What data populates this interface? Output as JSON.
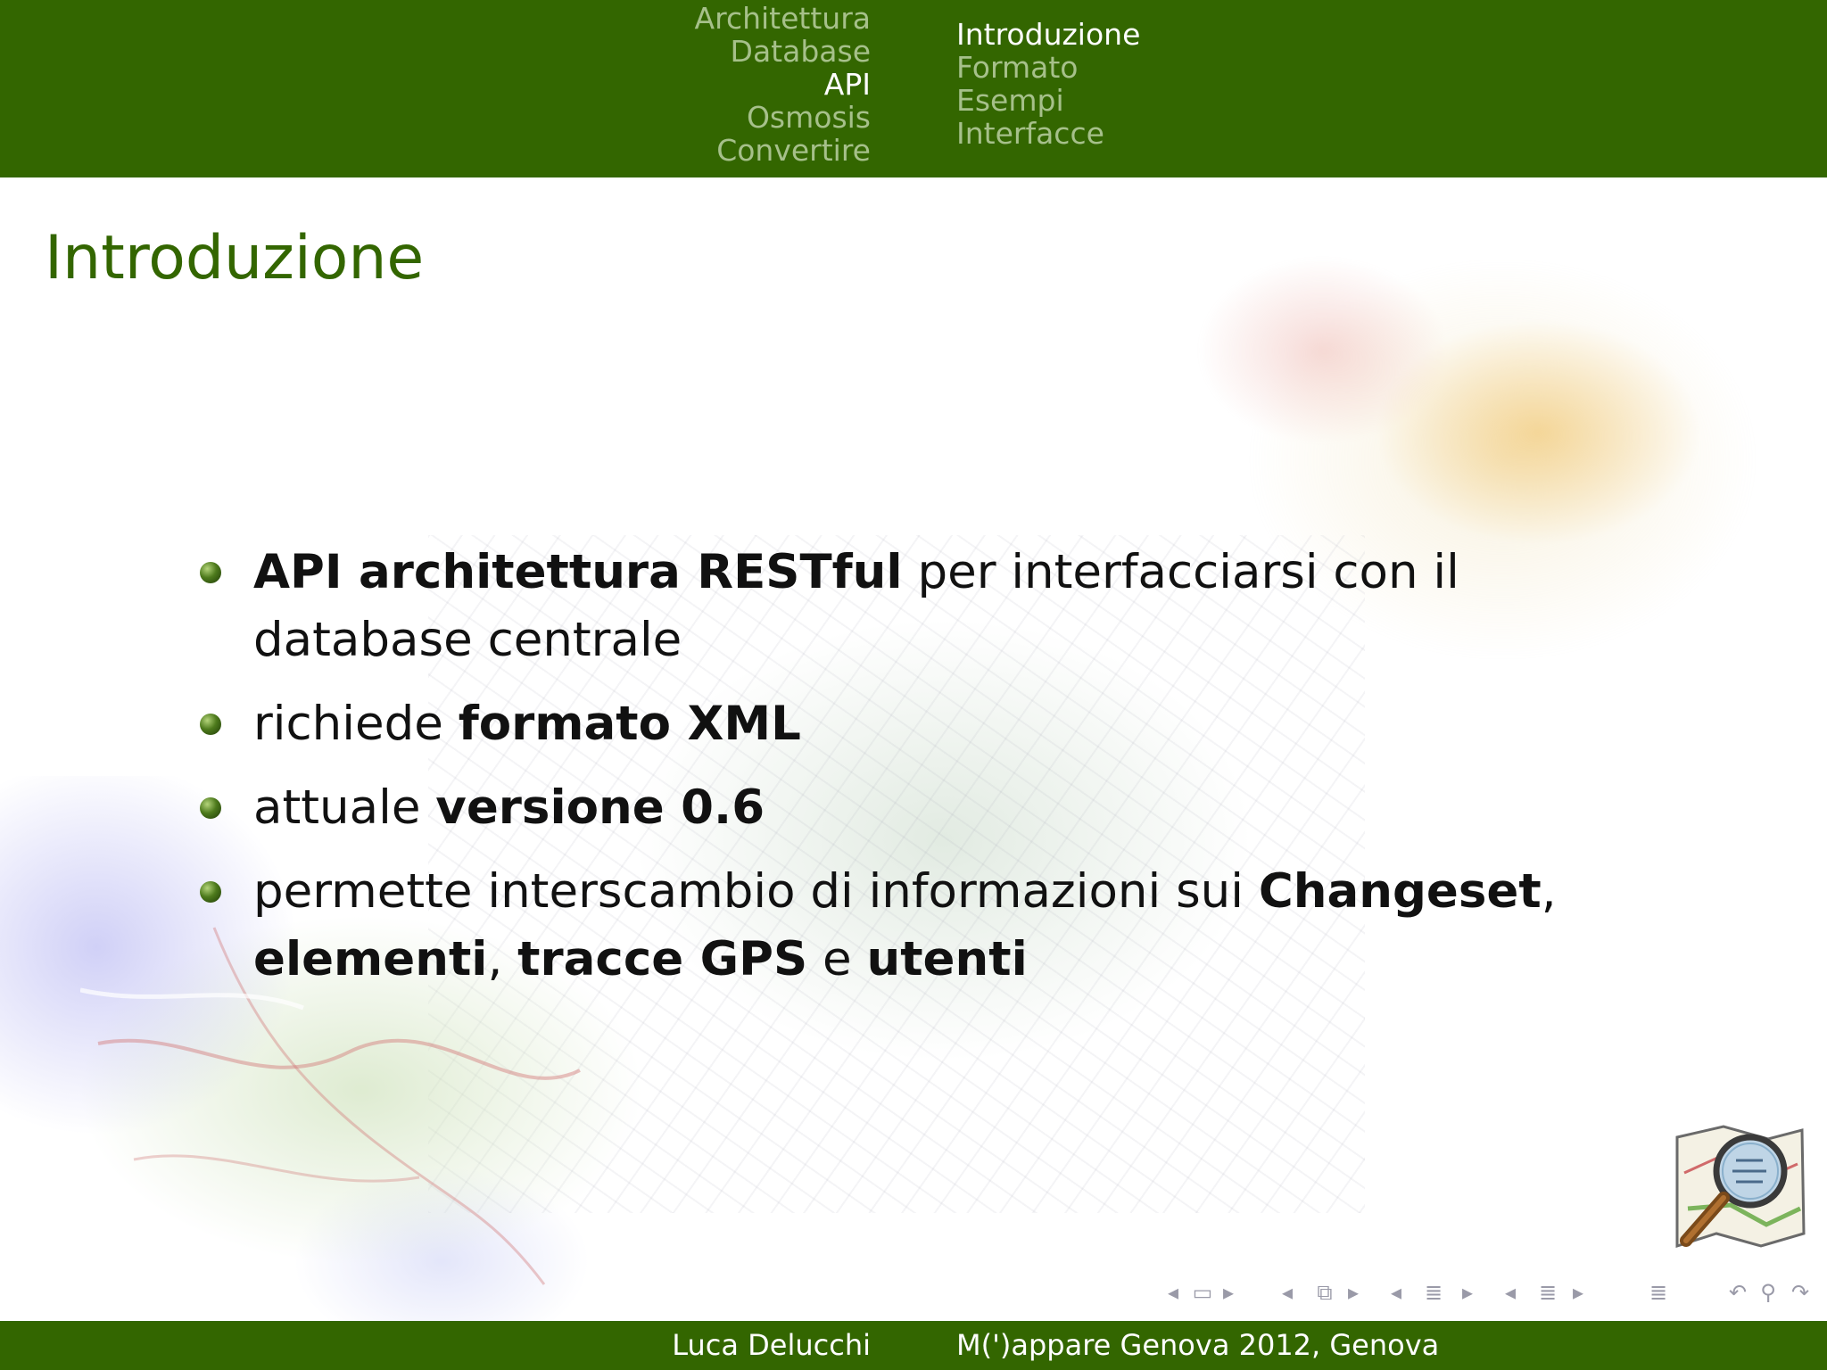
{
  "header": {
    "sections": [
      {
        "label": "Architettura",
        "active": false
      },
      {
        "label": "Database",
        "active": false
      },
      {
        "label": "API",
        "active": true
      },
      {
        "label": "Osmosis",
        "active": false
      },
      {
        "label": "Convertire",
        "active": false
      }
    ],
    "subsections": [
      {
        "label": "Introduzione",
        "active": true
      },
      {
        "label": "Formato",
        "active": false
      },
      {
        "label": "Esempi",
        "active": false
      },
      {
        "label": "Interfacce",
        "active": false
      }
    ]
  },
  "slide": {
    "title": "Introduzione",
    "bullets": [
      [
        {
          "text": "API architettura RESTful",
          "bold": true
        },
        {
          "text": " per interfacciarsi con il database centrale",
          "bold": false
        }
      ],
      [
        {
          "text": "richiede ",
          "bold": false
        },
        {
          "text": "formato XML",
          "bold": true
        }
      ],
      [
        {
          "text": "attuale ",
          "bold": false
        },
        {
          "text": "versione 0.6",
          "bold": true
        }
      ],
      [
        {
          "text": "permette interscambio di informazioni sui ",
          "bold": false
        },
        {
          "text": "Changeset",
          "bold": true
        },
        {
          "text": ", ",
          "bold": false
        },
        {
          "text": "elementi",
          "bold": true
        },
        {
          "text": ", ",
          "bold": false
        },
        {
          "text": "tracce GPS",
          "bold": true
        },
        {
          "text": " e ",
          "bold": false
        },
        {
          "text": "utenti",
          "bold": true
        }
      ]
    ]
  },
  "nav_symbols": [
    {
      "name": "slide-prev",
      "glyph": "◂",
      "icon": "arrow-left-icon"
    },
    {
      "name": "slide",
      "glyph": "▭",
      "icon": "slide-icon"
    },
    {
      "name": "slide-next",
      "glyph": "▸",
      "icon": "arrow-right-icon"
    },
    {
      "name": "frame-prev",
      "glyph": "◂",
      "icon": "arrow-left-icon"
    },
    {
      "name": "frame",
      "glyph": "⧉",
      "icon": "frame-icon"
    },
    {
      "name": "frame-next",
      "glyph": "▸",
      "icon": "arrow-right-icon"
    },
    {
      "name": "subsection-prev",
      "glyph": "◂",
      "icon": "arrow-left-icon"
    },
    {
      "name": "subsection",
      "glyph": "≣",
      "icon": "subsection-icon"
    },
    {
      "name": "subsection-next",
      "glyph": "▸",
      "icon": "arrow-right-icon"
    },
    {
      "name": "section-prev",
      "glyph": "◂",
      "icon": "arrow-left-icon"
    },
    {
      "name": "section",
      "glyph": "≣",
      "icon": "section-icon"
    },
    {
      "name": "section-next",
      "glyph": "▸",
      "icon": "arrow-right-icon"
    },
    {
      "name": "document",
      "glyph": "≣",
      "icon": "document-icon"
    },
    {
      "name": "back",
      "glyph": "↶",
      "icon": "undo-icon"
    },
    {
      "name": "search",
      "glyph": "⚲",
      "icon": "search-icon"
    },
    {
      "name": "forward",
      "glyph": "↷",
      "icon": "redo-icon"
    }
  ],
  "footer": {
    "author": "Luca Delucchi",
    "event": "M(')appare Genova 2012, Genova"
  },
  "colors": {
    "bar": "#336600",
    "nav_inactive": "#a6c08a",
    "nav_active": "#ffffff",
    "title": "#336600",
    "text": "#111111"
  },
  "logo": {
    "icon": "openstreetmap-logo"
  }
}
